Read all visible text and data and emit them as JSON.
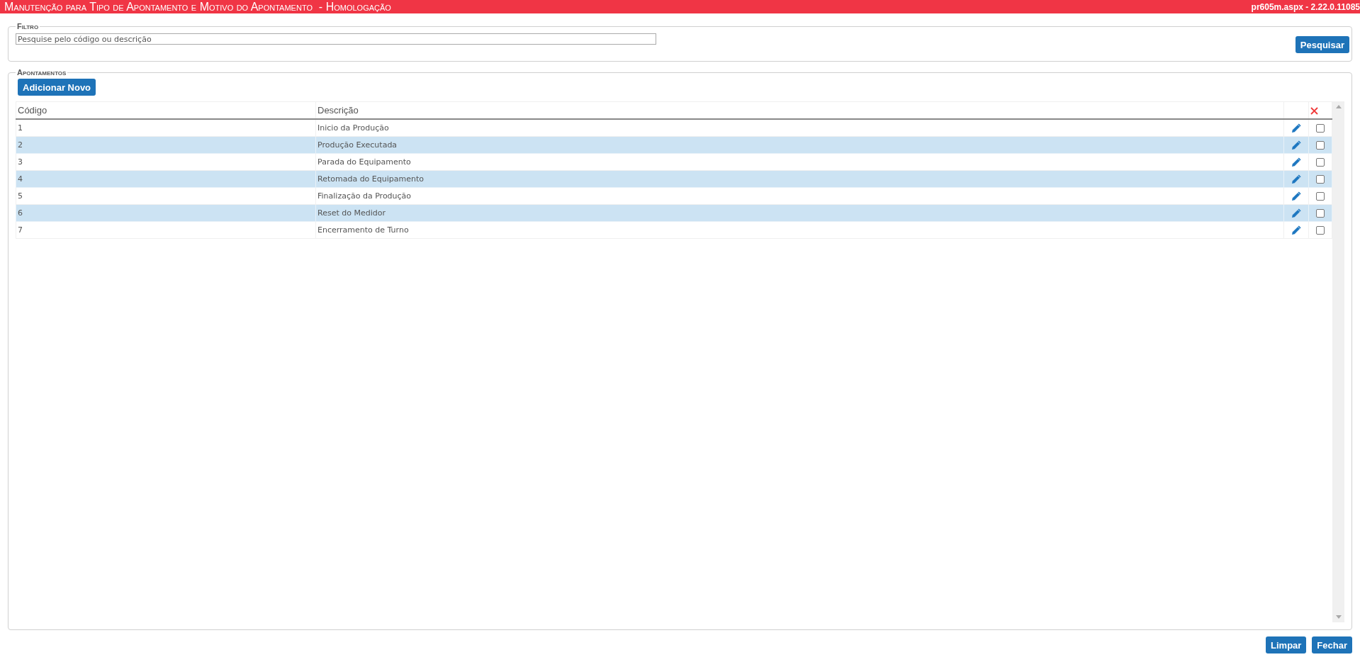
{
  "header": {
    "title": "Manutenção para Tipo de Apontamento e Motivo do Apontamento  - Homologação",
    "version": "pr605m.aspx - 2.22.0.11085"
  },
  "filter": {
    "legend": "Filtro",
    "search": {
      "placeholder": "Pesquise pelo código ou descrição"
    },
    "button": "Pesquisar"
  },
  "appointments": {
    "legend": "Apontamentos",
    "add_button": "Adicionar Novo",
    "table": {
      "columns": [
        "Código",
        "Descrição"
      ],
      "rows": [
        {
          "code": "1",
          "description": "Inicio da Produção",
          "checked": false
        },
        {
          "code": "2",
          "description": "Produção Executada",
          "checked": false
        },
        {
          "code": "3",
          "description": "Parada do Equipamento",
          "checked": false
        },
        {
          "code": "4",
          "description": "Retomada do Equipamento",
          "checked": false
        },
        {
          "code": "5",
          "description": "Finalização da Produção",
          "checked": false
        },
        {
          "code": "6",
          "description": "Reset do Medidor",
          "checked": false
        },
        {
          "code": "7",
          "description": "Encerramento de Turno",
          "checked": false
        }
      ]
    }
  },
  "footer_buttons": [
    "Limpar",
    "Fechar"
  ]
}
